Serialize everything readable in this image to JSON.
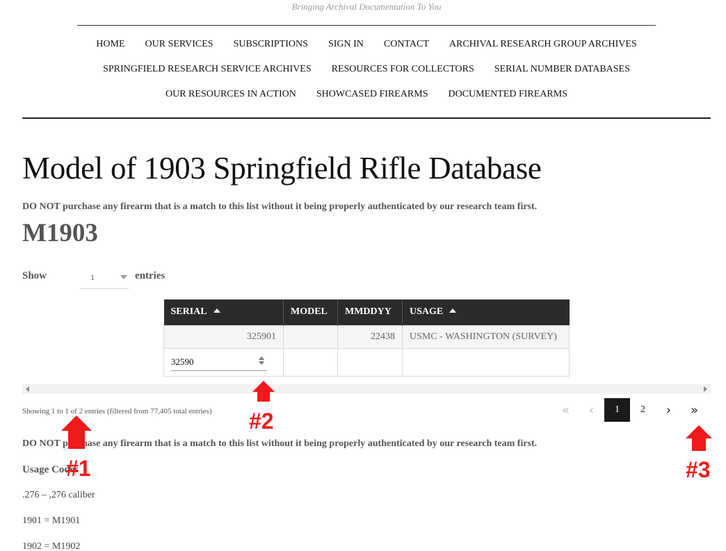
{
  "tagline": "Bringing Archival Documentation To You",
  "nav": {
    "row1": [
      "HOME",
      "OUR SERVICES",
      "SUBSCRIPTIONS",
      "SIGN IN",
      "CONTACT",
      "ARCHIVAL RESEARCH GROUP ARCHIVES"
    ],
    "row2": [
      "SPRINGFIELD RESEARCH SERVICE ARCHIVES",
      "RESOURCES FOR COLLECTORS",
      "SERIAL NUMBER DATABASES"
    ],
    "row3": [
      "OUR RESOURCES IN ACTION",
      "SHOWCASED FIREARMS",
      "DOCUMENTED FIREARMS"
    ]
  },
  "page_title": "Model of 1903 Springfield Rifle Database",
  "warning": "DO NOT purchase any firearm that is a match to this list without it being properly authenticated by our research team first.",
  "model_heading": "M1903",
  "length": {
    "show_label": "Show",
    "value": "1",
    "entries_label": "entries"
  },
  "table": {
    "headers": [
      "SERIAL",
      "MODEL",
      "MMDDYY",
      "USAGE"
    ],
    "row": {
      "serial": "325901",
      "model": "",
      "mmddyy": "22438",
      "usage": "USMC - WASHINGTON (SURVEY)"
    },
    "filter_value": "32590"
  },
  "info": "Showing 1 to 1 of 2 entries (filtered from 77,405 total entries)",
  "pagination": {
    "first": "«",
    "prev": "‹",
    "page1": "1",
    "page2": "2",
    "next": "›",
    "last": "»"
  },
  "usage": {
    "title": "Usage Codes",
    "lines": [
      ".276 – ,276 caliber",
      "1901 = M1901",
      "1902 = M1902"
    ]
  },
  "annotations": {
    "m1": "#1",
    "m2": "#2",
    "m3": "#3",
    "color": "#f01a1a"
  }
}
